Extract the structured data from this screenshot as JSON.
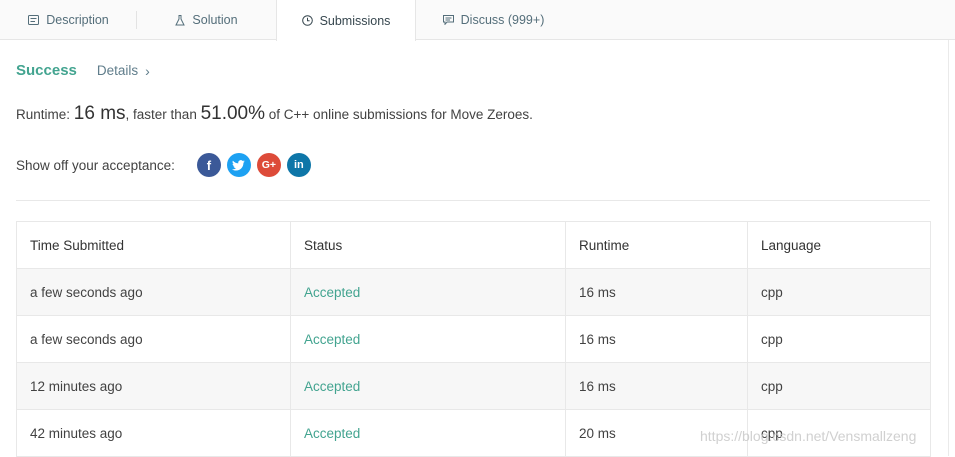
{
  "tabs": [
    {
      "label": "Description",
      "icon": "description-icon"
    },
    {
      "label": "Solution",
      "icon": "flask-icon"
    },
    {
      "label": "Submissions",
      "icon": "clock-icon",
      "active": true
    },
    {
      "label": "Discuss (999+)",
      "icon": "comment-icon"
    }
  ],
  "result": {
    "status": "Success",
    "details_label": "Details",
    "details_chevron": "›"
  },
  "runtime": {
    "prefix": "Runtime: ",
    "value": "16 ms",
    "middle": ", faster than ",
    "percent": "51.00%",
    "suffix": " of C++ online submissions for Move Zeroes."
  },
  "share": {
    "label": "Show off your acceptance:",
    "networks": [
      {
        "name": "facebook-icon",
        "glyph": "f",
        "color": "#3b5998"
      },
      {
        "name": "twitter-icon",
        "glyph": "t",
        "color": "#1da1f2"
      },
      {
        "name": "google-plus-icon",
        "glyph": "G+",
        "color": "#dd4b39"
      },
      {
        "name": "linkedin-icon",
        "glyph": "in",
        "color": "#0e76a8"
      }
    ]
  },
  "table": {
    "headers": [
      "Time Submitted",
      "Status",
      "Runtime",
      "Language"
    ],
    "rows": [
      [
        "a few seconds ago",
        "Accepted",
        "16 ms",
        "cpp"
      ],
      [
        "a few seconds ago",
        "Accepted",
        "16 ms",
        "cpp"
      ],
      [
        "12 minutes ago",
        "Accepted",
        "16 ms",
        "cpp"
      ],
      [
        "42 minutes ago",
        "Accepted",
        "20 ms",
        "cpp"
      ]
    ]
  },
  "watermark": "https://blog.csdn.net/Vensmallzeng",
  "colors": {
    "accent": "#43a490",
    "text": "#424242",
    "muted": "#607d8b"
  }
}
